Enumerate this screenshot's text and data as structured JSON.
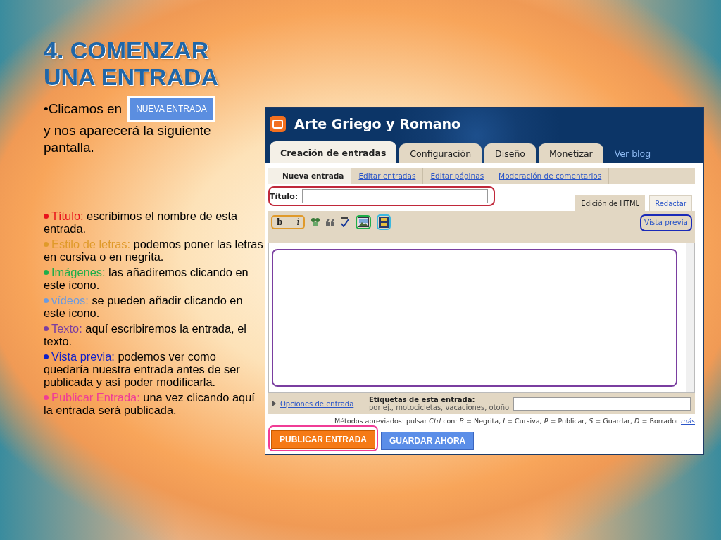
{
  "slide": {
    "title": "4. COMENZAR UNA ENTRADA",
    "intro": {
      "before": "•Clicamos en",
      "button": "NUEVA ENTRADA",
      "after": "y  nos aparecerá la siguiente pantalla."
    },
    "bullets": [
      {
        "term": "Título:",
        "text": "escribimos el nombre de esta entrada.",
        "color": "#e8131b"
      },
      {
        "term": "Estilo de letras:",
        "text": "podemos poner las letras en cursiva o en negrita.",
        "color": "#e09a2a"
      },
      {
        "term": "Imágenes:",
        "text": "las añadiremos clicando en este icono.",
        "color": "#1fae4a"
      },
      {
        "term": "vídeos:",
        "text": "se pueden añadir clicando en este icono.",
        "color": "#6b9be0"
      },
      {
        "term": "Texto:",
        "text": "aquí escribiremos la entrada, el texto.",
        "color": "#7a3ea0"
      },
      {
        "term": "Vista previa:",
        "text": "podemos ver como quedaría nuestra entrada antes de ser publicada y así poder modificarla.",
        "color": "#1020c8"
      },
      {
        "term": "Publicar Entrada:",
        "text": "una vez clicando aquí la entrada será publicada.",
        "color": "#f03c96"
      }
    ]
  },
  "editor": {
    "blog_title": "Arte Griego y Romano",
    "tabs": [
      {
        "label": "Creación de entradas",
        "selected": true
      },
      {
        "label": "Configuración",
        "selected": false
      },
      {
        "label": "Diseño",
        "selected": false
      },
      {
        "label": "Monetizar",
        "selected": false
      }
    ],
    "view_blog": "Ver blog",
    "subtabs": [
      {
        "label": "Nueva entrada",
        "selected": true
      },
      {
        "label": "Editar entradas",
        "selected": false
      },
      {
        "label": "Editar páginas",
        "selected": false
      },
      {
        "label": "Moderación de comentarios",
        "selected": false
      }
    ],
    "title_label": "Título:",
    "modes": [
      {
        "label": "Edición de HTML",
        "selected": true
      },
      {
        "label": "Redactar",
        "selected": false
      }
    ],
    "toolbar": [
      {
        "kind": "bold",
        "label": "b"
      },
      {
        "kind": "italic",
        "label": "i"
      },
      {
        "kind": "link"
      },
      {
        "kind": "quote"
      },
      {
        "kind": "spellcheck"
      },
      {
        "kind": "image"
      },
      {
        "kind": "video"
      }
    ],
    "preview": "Vista previa",
    "options": "Opciones de entrada",
    "labels_title": "Etiquetas de esta entrada:",
    "labels_hint": "por ej., motocicletas, vacaciones, otoño",
    "shortcuts": "Métodos abreviados: pulsar *Ctrl* con: *B* = Negrita, *I* = Cursiva, *P* = Publicar, *S* = Guardar, *D* = Borrador",
    "more": "más",
    "buttons": [
      {
        "label": "PUBLICAR ENTRADA",
        "kind": "publish"
      },
      {
        "label": "GUARDAR AHORA",
        "kind": "save"
      }
    ]
  }
}
